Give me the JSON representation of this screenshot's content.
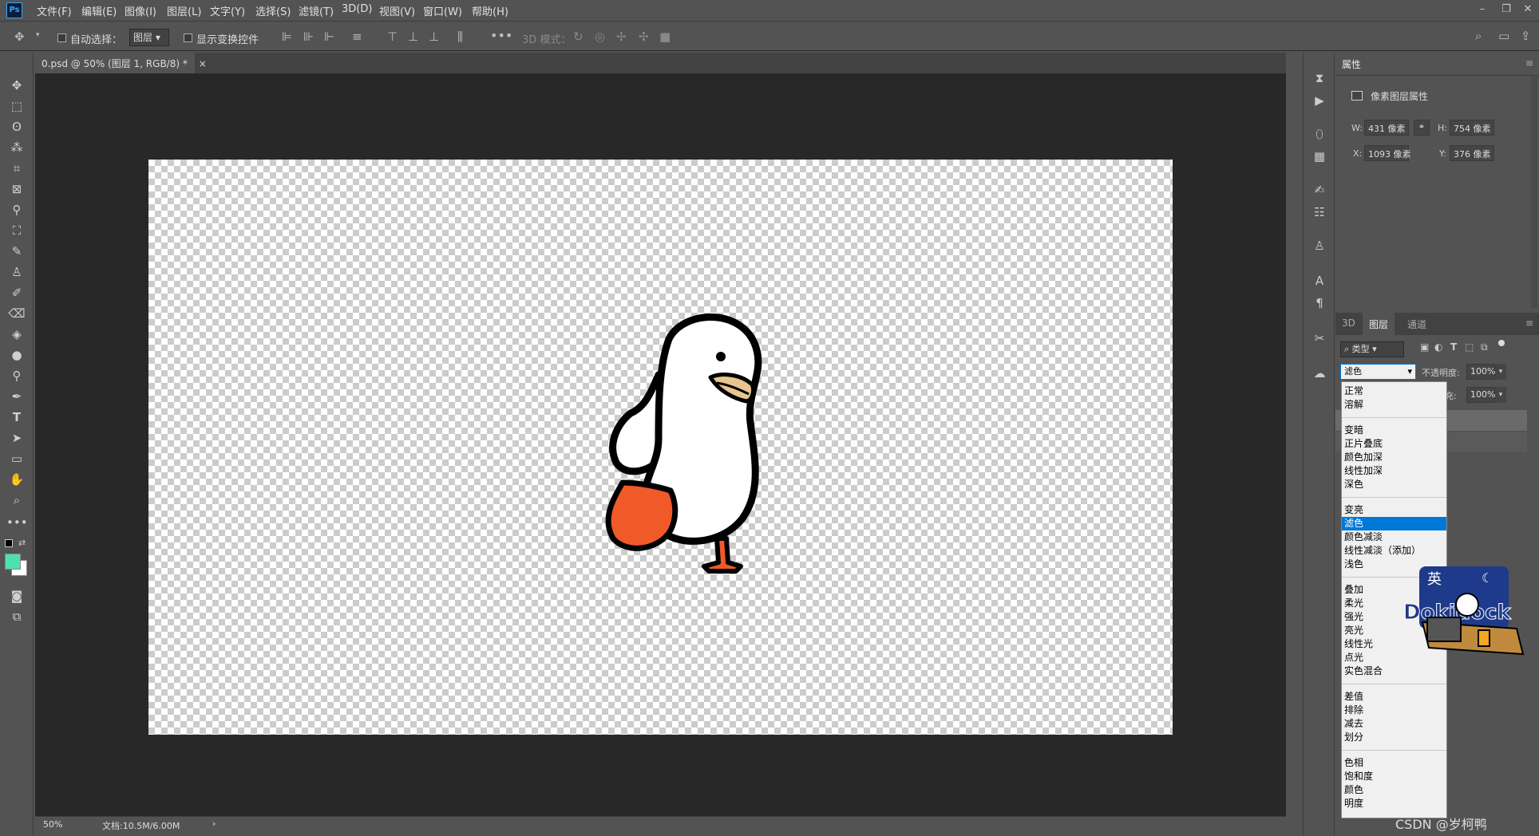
{
  "app": {
    "logo": "Ps"
  },
  "menubar": {
    "items": [
      "文件(F)",
      "编辑(E)",
      "图像(I)",
      "图层(L)",
      "文字(Y)",
      "选择(S)",
      "滤镜(T)",
      "3D(D)",
      "视图(V)",
      "窗口(W)",
      "帮助(H)"
    ]
  },
  "window_controls": {
    "minimize": "–",
    "restore": "❐",
    "close": "✕"
  },
  "options": {
    "auto_select_label": "自动选择：",
    "auto_select_target": "图层",
    "show_transform_label": "显示变换控件",
    "mode_3d_label": "3D 模式："
  },
  "document": {
    "tab_label": "0.psd @ 50% (图层 1, RGB/8) *",
    "tab_close": "×",
    "zoom": "50%",
    "doc_info": "文档:10.5M/6.00M"
  },
  "properties_panel": {
    "title": "属性",
    "subtitle": "像素图层属性",
    "w_label": "W:",
    "w_value": "431 像素",
    "h_label": "H:",
    "h_value": "754 像素",
    "x_label": "X:",
    "x_value": "1093 像素",
    "y_label": "Y:",
    "y_value": "376 像素"
  },
  "layers_panel": {
    "tabs": [
      "3D",
      "图层",
      "通道"
    ],
    "active_tab": "图层",
    "filter_kind": "类型",
    "blend_mode": "滤色",
    "opacity_label": "不透明度:",
    "opacity_value": "100%",
    "fill_label": "填充:",
    "fill_value": "100%"
  },
  "blend_dropdown": {
    "selected": "滤色",
    "groups": [
      [
        "正常",
        "溶解"
      ],
      [
        "变暗",
        "正片叠底",
        "颜色加深",
        "线性加深",
        "深色"
      ],
      [
        "变亮",
        "滤色",
        "颜色减淡",
        "线性减淡（添加）",
        "浅色"
      ],
      [
        "叠加",
        "柔光",
        "强光",
        "亮光",
        "线性光",
        "点光",
        "实色混合"
      ],
      [
        "差值",
        "排除",
        "减去",
        "划分"
      ],
      [
        "色相",
        "饱和度",
        "颜色",
        "明度"
      ]
    ]
  },
  "sticker": {
    "top_text": "英",
    "word": "Dokidock"
  },
  "watermark": "CSDN @岁柯鸭",
  "colors": {
    "foreground": "#4fe0b0",
    "background": "#ffffff",
    "duck_foot": "#f05a28",
    "duck_beak": "#e8c590"
  }
}
